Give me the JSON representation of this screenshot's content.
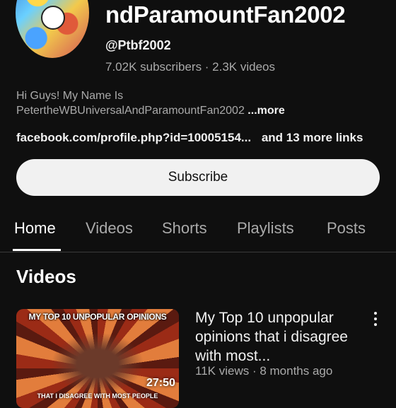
{
  "channel": {
    "title": "ndParamountFan2002",
    "handle": "@Ptbf2002",
    "stats": "7.02K subscribers · 2.3K videos",
    "description_line1": "Hi Guys! My Name Is",
    "description_line2": "PetertheWBUniversalAndParamountFan2002",
    "description_more": "...more",
    "link": "facebook.com/profile.php?id=10005154...",
    "more_links": "and 13 more links",
    "subscribe_label": "Subscribe"
  },
  "tabs": [
    {
      "label": "Home",
      "active": true
    },
    {
      "label": "Videos"
    },
    {
      "label": "Shorts"
    },
    {
      "label": "Playlists"
    },
    {
      "label": "Posts"
    }
  ],
  "section": {
    "title": "Videos"
  },
  "videos": [
    {
      "thumbnail_title": "MY TOP 10 UNPOPULAR OPINIONS",
      "thumbnail_bottom": "THAT I DISAGREE WITH MOST PEOPLE",
      "duration": "27:50",
      "title": "My Top 10 unpopular opinions that i disagree with most...",
      "meta": "11K views · 8 months ago"
    }
  ],
  "icons": {
    "kebab": "more-vertical-icon"
  },
  "colors": {
    "background": "#0f0f0f",
    "primary_text": "#f1f1f1",
    "secondary_text": "#aaaaaa",
    "subscribe_bg": "#f1f1f1"
  }
}
